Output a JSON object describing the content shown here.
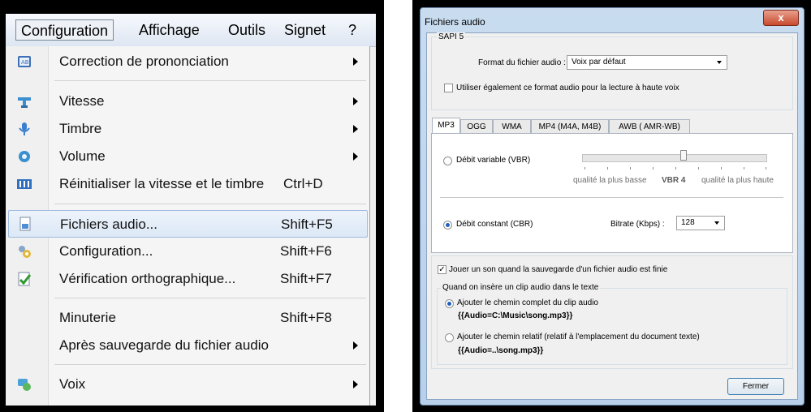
{
  "menu": {
    "menubar": [
      "Configuration",
      "Affichage",
      "Outils",
      "Signet",
      "?"
    ],
    "items": [
      {
        "label": "Correction de prononciation",
        "shortcut": "",
        "submenu": true,
        "icon": "pronunciation-icon"
      },
      {
        "label": "Vitesse",
        "shortcut": "",
        "submenu": true,
        "icon": "speed-icon"
      },
      {
        "label": "Timbre",
        "shortcut": "",
        "submenu": true,
        "icon": "microphone-icon"
      },
      {
        "label": "Volume",
        "shortcut": "",
        "submenu": true,
        "icon": "volume-icon"
      },
      {
        "label": "Réinitialiser la vitesse et le timbre",
        "shortcut": "Ctrl+D",
        "submenu": false,
        "icon": "equalizer-icon"
      },
      {
        "label": "Fichiers audio...",
        "shortcut": "Shift+F5",
        "submenu": false,
        "icon": "audio-file-icon"
      },
      {
        "label": "Configuration...",
        "shortcut": "Shift+F6",
        "submenu": false,
        "icon": "gears-icon"
      },
      {
        "label": "Vérification orthographique...",
        "shortcut": "Shift+F7",
        "submenu": false,
        "icon": "spellcheck-icon"
      },
      {
        "label": "Minuterie",
        "shortcut": "Shift+F8",
        "submenu": false,
        "icon": ""
      },
      {
        "label": "Après sauvegarde du fichier audio",
        "shortcut": "",
        "submenu": true,
        "icon": ""
      },
      {
        "label": "Voix",
        "shortcut": "",
        "submenu": true,
        "icon": "voice-icon"
      }
    ]
  },
  "dialog": {
    "title": "Fichiers audio",
    "close": "x",
    "sapi_group": "SAPI 5",
    "format_label": "Format du fichier audio :",
    "format_value": "Voix par défaut",
    "also_use_label": "Utiliser également ce format audio pour la lecture à haute voix",
    "also_use_checked": false,
    "tabs": [
      "MP3",
      "OGG",
      "WMA",
      "MP4 (M4A, M4B)",
      "AWB ( AMR-WB)"
    ],
    "active_tab": "MP3",
    "vbr_label": "Débit variable (VBR)",
    "vbr_selected": false,
    "slider_min_label": "qualité la plus basse",
    "slider_value_label": "VBR 4",
    "slider_max_label": "qualité la plus haute",
    "slider_level": 0.55,
    "cbr_label": "Débit constant (CBR)",
    "cbr_selected": true,
    "bitrate_label": "Bitrate (Kbps) :",
    "bitrate_value": "128",
    "play_sound_label": "Jouer un son quand la sauvegarde d'un fichier audio est finie",
    "play_sound_checked": true,
    "insert_group": "Quand on insère un clip audio dans le texte",
    "full_path_label": "Ajouter le chemin complet du clip audio",
    "full_path_example": "{{Audio=C:\\Music\\song.mp3}}",
    "full_path_selected": true,
    "relative_path_label": "Ajouter le chemin relatif (relatif à l'emplacement du document texte)",
    "relative_path_example": "{{Audio=..\\song.mp3}}",
    "relative_path_selected": false,
    "close_button": "Fermer"
  }
}
